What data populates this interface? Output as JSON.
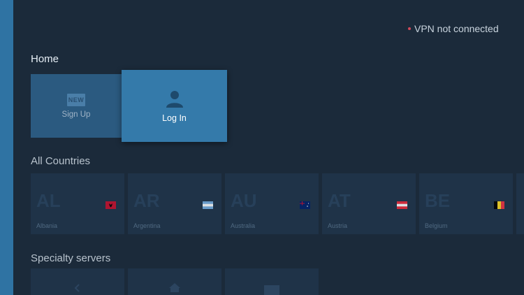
{
  "vpn_status": {
    "text": "VPN not connected",
    "dot_color": "#d04a5a"
  },
  "home": {
    "title": "Home",
    "tiles": [
      {
        "label": "Sign Up",
        "badge": "NEW",
        "icon": "new-badge-icon"
      },
      {
        "label": "Log In",
        "icon": "user-icon"
      }
    ]
  },
  "countries": {
    "title": "All Countries",
    "items": [
      {
        "code": "AL",
        "name": "Albania",
        "flag_colors": [
          "#c8102e",
          "#000000"
        ]
      },
      {
        "code": "AR",
        "name": "Argentina",
        "flag_colors": [
          "#74acdf",
          "#ffffff"
        ]
      },
      {
        "code": "AU",
        "name": "Australia",
        "flag_colors": [
          "#012169",
          "#c8102e"
        ]
      },
      {
        "code": "AT",
        "name": "Austria",
        "flag_colors": [
          "#ed2939",
          "#ffffff"
        ]
      },
      {
        "code": "BE",
        "name": "Belgium",
        "flag_colors": [
          "#000000",
          "#fdda24",
          "#ef3340"
        ]
      }
    ]
  },
  "specialty": {
    "title": "Specialty servers",
    "items": [
      {
        "icon": "chevron-left-icon"
      },
      {
        "icon": "home-icon"
      },
      {
        "icon": "screen-icon"
      }
    ]
  }
}
